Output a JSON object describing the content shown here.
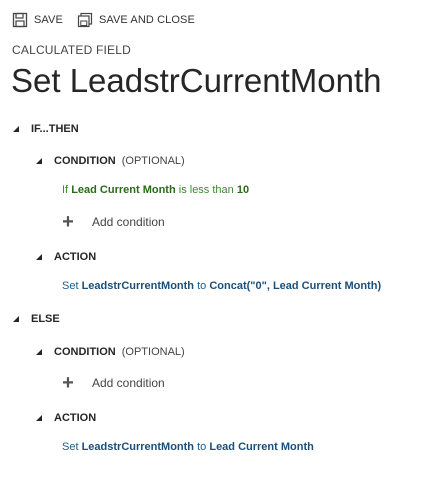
{
  "toolbar": {
    "save_label": "SAVE",
    "save_close_label": "SAVE AND CLOSE"
  },
  "page": {
    "type_label": "CALCULATED FIELD",
    "title": "Set LeadstrCurrentMonth"
  },
  "if_then": {
    "header": "IF...THEN",
    "condition": {
      "header": "CONDITION",
      "optional": "(OPTIONAL)",
      "statement": {
        "if": "If",
        "field": "Lead Current Month",
        "op": "is less than",
        "value": "10"
      },
      "add_label": "Add condition"
    },
    "action": {
      "header": "ACTION",
      "statement": {
        "set": "Set",
        "target": "LeadstrCurrentMonth",
        "to": "to",
        "expr": "Concat(\"0\", Lead Current Month)"
      }
    }
  },
  "else": {
    "header": "ELSE",
    "condition": {
      "header": "CONDITION",
      "optional": "(OPTIONAL)",
      "add_label": "Add condition"
    },
    "action": {
      "header": "ACTION",
      "statement": {
        "set": "Set",
        "target": "LeadstrCurrentMonth",
        "to": "to",
        "expr": "Lead Current Month"
      }
    }
  }
}
